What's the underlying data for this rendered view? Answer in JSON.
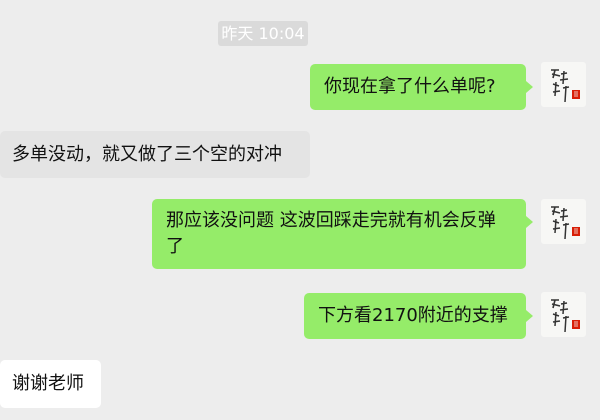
{
  "chat": {
    "timestamp": "昨天 10:04",
    "messages": [
      {
        "from": "me",
        "text": "你现在拿了什么单呢?"
      },
      {
        "from": "other",
        "text": "多单没动，就又做了三个空的对冲"
      },
      {
        "from": "me",
        "text": "那应该没问题 这波回踩走完就有机会反弹了"
      },
      {
        "from": "me",
        "text": "下方看2170附近的支撑"
      },
      {
        "from": "other",
        "text": "谢谢老师"
      }
    ]
  },
  "colors": {
    "background": "#ededed",
    "outgoing_bubble": "#95ec69",
    "incoming_bubble_gray": "#e4e4e4",
    "incoming_bubble_white": "#ffffff",
    "avatar_seal": "#d81e06"
  },
  "icons": {
    "avatar": "calligraphy-avatar-icon"
  }
}
